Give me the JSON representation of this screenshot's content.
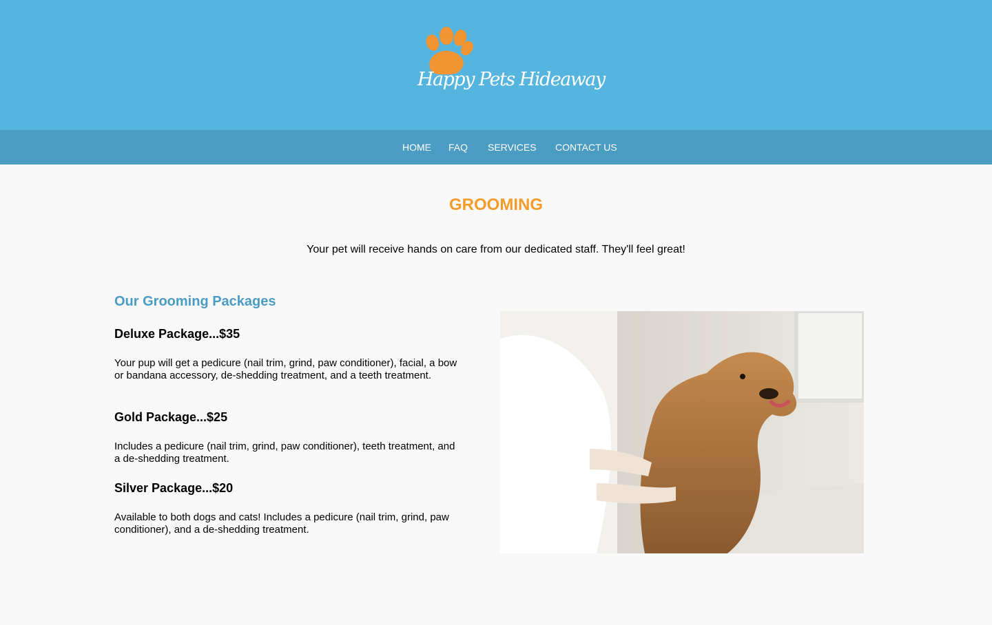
{
  "brand": {
    "name": "Happy Pets Hideaway",
    "colors": {
      "header": "#56b5df",
      "nav": "#4a9cc2",
      "accent": "#f39c2b",
      "paw": "#f39432"
    },
    "logo_icon": "paw-print-icon"
  },
  "nav": {
    "items": [
      {
        "label": "HOME"
      },
      {
        "label": "FAQ"
      },
      {
        "label": "SERVICES"
      },
      {
        "label": "CONTACT US"
      }
    ]
  },
  "main": {
    "title": "GROOMING",
    "intro": "Your pet will receive hands on care from our dedicated staff. They'll feel great!",
    "packages_heading": "Our Grooming Packages",
    "packages": [
      {
        "title": "Deluxe Package...$35",
        "description": "Your pup will get a pedicure (nail trim, grind, paw conditioner), facial, a bow or bandana accessory, de-shedding treatment, and a teeth treatment."
      },
      {
        "title": "Gold Package...$25",
        "description": "Includes a pedicure (nail trim, grind, paw conditioner), teeth treatment, and a de-shedding treatment."
      },
      {
        "title": "Silver Package...$20",
        "description": "Available to both dogs and cats! Includes a pedicure (nail trim, grind, paw conditioner), and a de-shedding treatment."
      }
    ],
    "photo_icon": "dog-bath-photo"
  }
}
